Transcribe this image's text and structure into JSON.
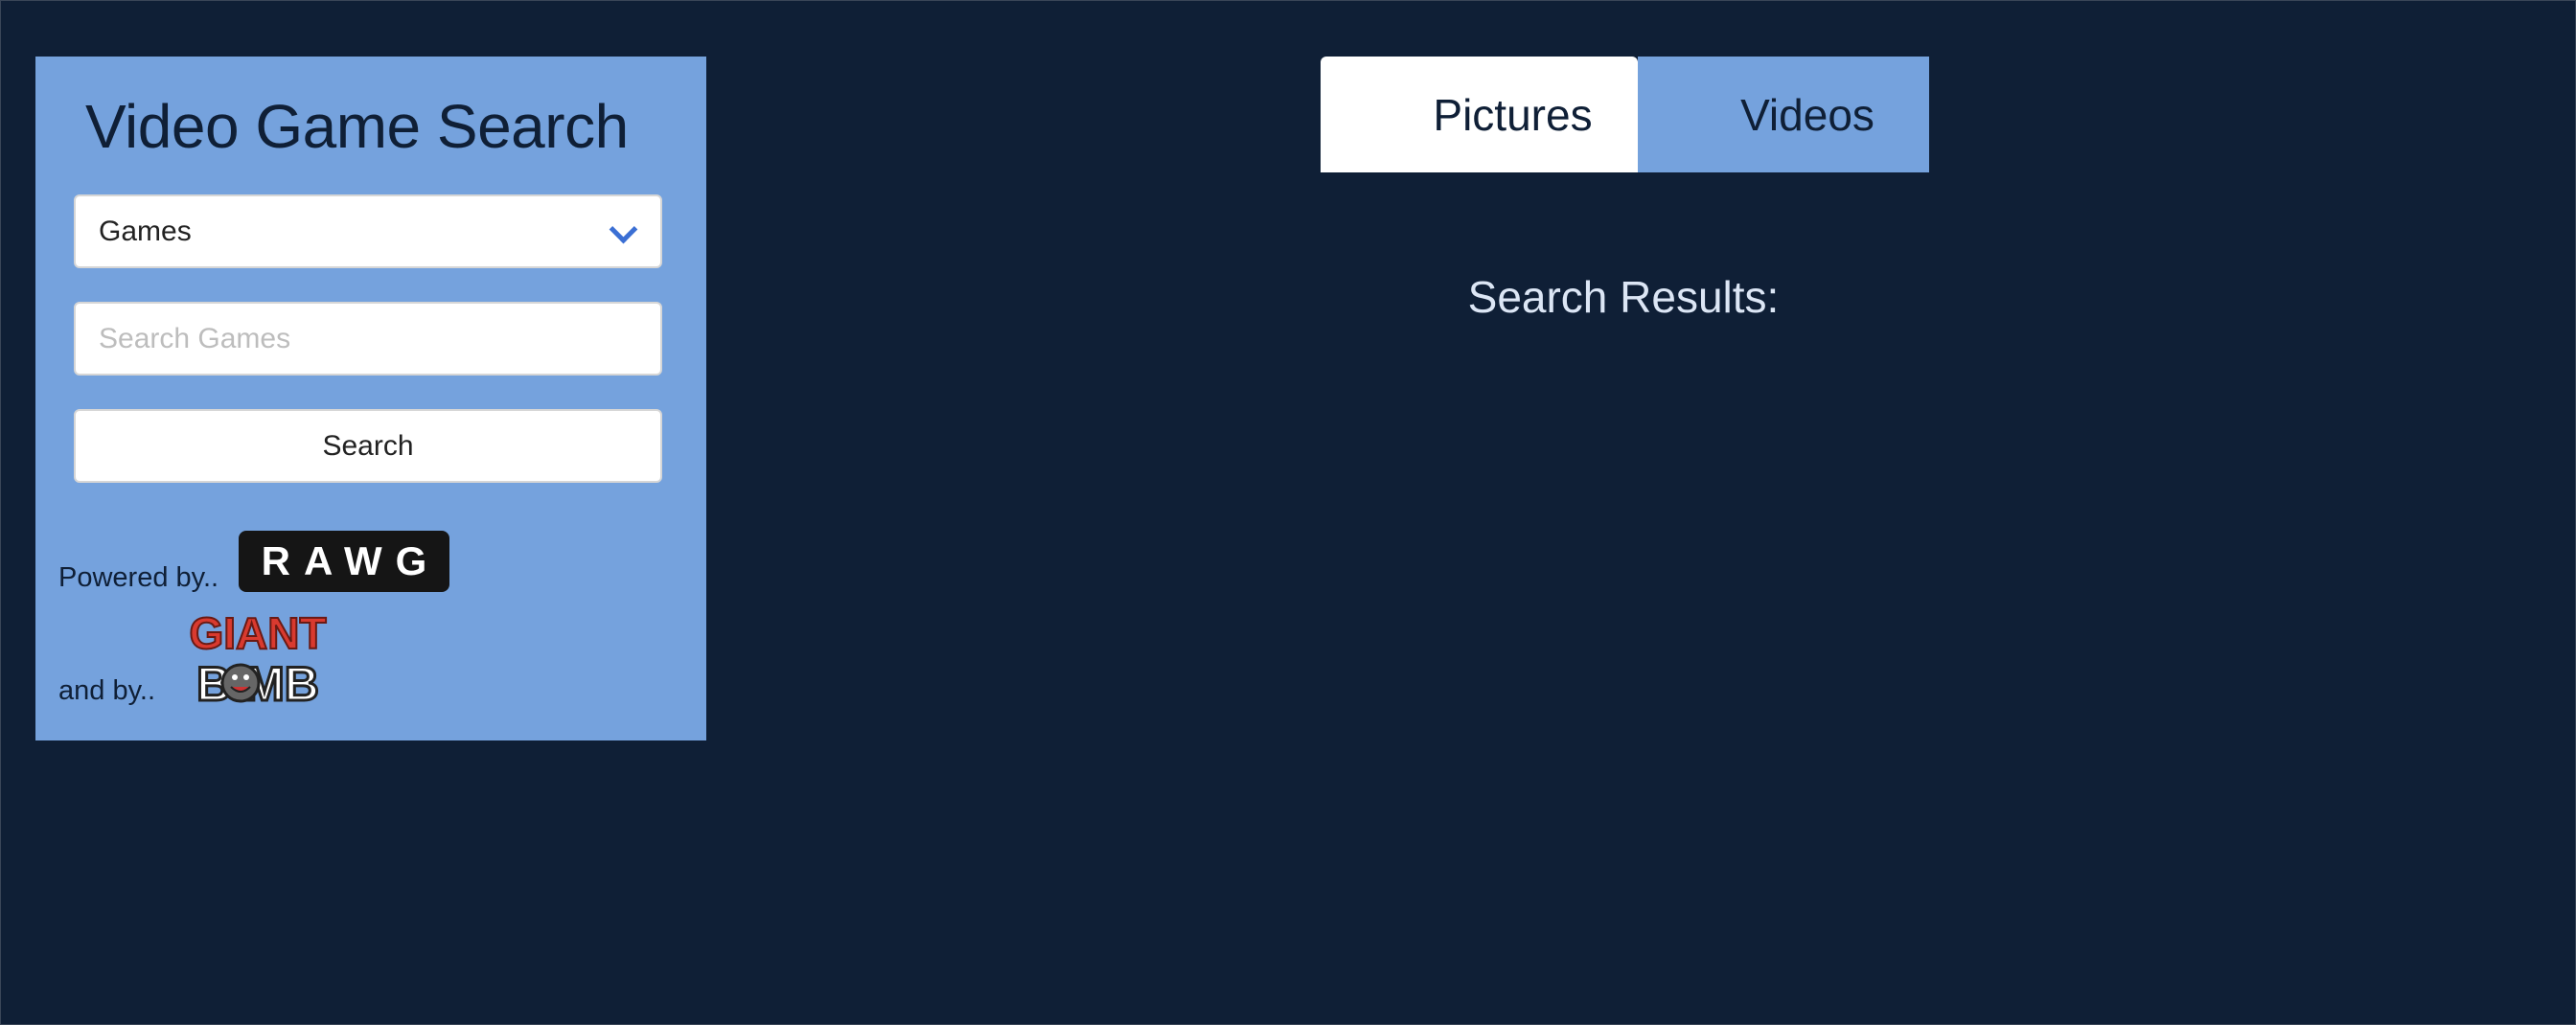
{
  "sidebar": {
    "title": "Video Game Search",
    "select": {
      "selected": "Games"
    },
    "search_input": {
      "value": "",
      "placeholder": "Search Games"
    },
    "search_button": "Search",
    "powered_by": "Powered by..",
    "rawg_logo": "RAWG",
    "and_by": "and by..",
    "giantbomb_logo": "GIANT BOMB"
  },
  "tabs": [
    {
      "label": "Pictures",
      "active": true
    },
    {
      "label": "Videos",
      "active": false
    }
  ],
  "main": {
    "results_heading": "Search Results:"
  },
  "colors": {
    "background": "#0f1f36",
    "panel": "#75a2dd",
    "chevron": "#3b6fd4"
  }
}
